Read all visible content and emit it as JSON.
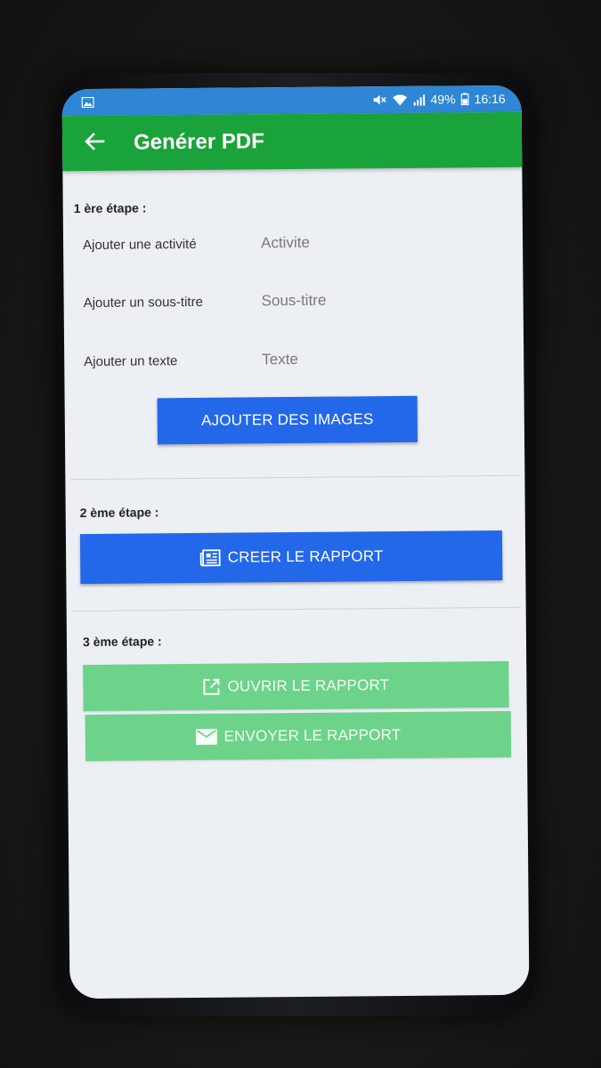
{
  "status_bar": {
    "battery": "49%",
    "time": "16:16",
    "icons": [
      "gallery-notification-icon",
      "mute-icon",
      "wifi-icon",
      "signal-icon",
      "battery-icon"
    ]
  },
  "app_bar": {
    "title": "Genérer PDF",
    "back_icon": "arrow-back-icon",
    "color": "#1aa33a"
  },
  "step1": {
    "label": "1 ère étape :",
    "fields": [
      {
        "label": "Ajouter une activité",
        "placeholder": "Activite",
        "value": ""
      },
      {
        "label": "Ajouter un sous-titre",
        "placeholder": "Sous-titre",
        "value": ""
      },
      {
        "label": "Ajouter un texte",
        "placeholder": "Texte",
        "value": ""
      }
    ],
    "add_images_label": "AJOUTER DES IMAGES"
  },
  "step2": {
    "label": "2 ème étape :",
    "create_report_label": "CREER LE RAPPORT",
    "create_report_icon": "newspaper-icon"
  },
  "step3": {
    "label": "3 ème étape :",
    "open_report_label": "OUVRIR LE RAPPORT",
    "open_report_icon": "open-external-icon",
    "send_report_label": "ENVOYER LE RAPPORT",
    "send_report_icon": "mail-icon"
  },
  "colors": {
    "primary_blue": "#2368e8",
    "success_green": "#6dd38a",
    "status_bar": "#2e86d4"
  }
}
